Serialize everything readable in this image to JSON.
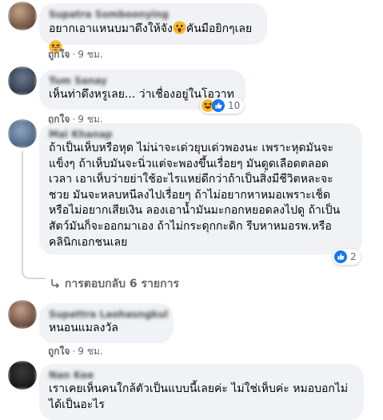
{
  "comments": [
    {
      "author": "Supatra Somboonying",
      "text": "อยากเอาแหนบมาดึงให้จัง",
      "emoji1": "face-with-open-mouth",
      "text_after_emoji": "คันมือยิกๆเลย",
      "emoji2": "grinning-squinting-face",
      "like_label": "ถูกใจ",
      "time": "9 ชม."
    },
    {
      "author": "Tum Sanay",
      "text": "เห็นท่าดึงหรูเลย... ว่าเชื่องอยู่ในโอวาท",
      "like_label": "ถูกใจ",
      "time": "9 ชม.",
      "reaction_count": "10",
      "reactions": [
        "haha",
        "like"
      ]
    },
    {
      "author": "Mai Khanap",
      "text": "ถ้าเป็นเห็บหรือหุด ไม่น่าจะเด่วยุบเด่วพองนะ เพราะหุดมันจะ\nแข็งๆ ถ้าเห็บมันจะนิ่วแต่จะพองขึ้นเรื่อยๆ มันดูดเลือดตลอด\nเวลา เอาเห็บว่ายย่าใช้อะไรแหย่ดีกว่าถ้าเป็นสิ่งมีชีวิตหละจะ\nชวย มันจะหลบหนีลงไปเรื่อยๆ ถ้าไม่อยากหาหมอเพราะเช็ด\nหรือไม่อยากเสียเงิน ลองเอาน้ำมันมะกอกหยอดลงไปดู ถ้าเป็น\nสัตว์มันก็จะออกมาเอง ถ้าไม่กระดุกกะดิก รีบหาหมอรพ.หรือ\nคลินิกเอกชนเลย",
      "reaction_count": "2",
      "reactions": [
        "like"
      ],
      "replies_label": "การตอบกลับ 6 รายการ"
    },
    {
      "author": "Supattra Laohasngkul",
      "text": "หนอนแมลงวัล",
      "like_label": "ถูกใจ",
      "time": "9 ชม."
    },
    {
      "author": "Nan Kee",
      "text": "เราเคยเห็นคนใกล้ตัวเป็นแบบนี้เลยค่ะ ไม่ใช่เห็บค่ะ หมอบอกไม่\nได้เป็นอะไร"
    }
  ],
  "colors": {
    "bubble": "#f0f2f5",
    "meta_text": "#65676b",
    "like_blue": "#1877f2",
    "haha_yellow": "#f7b928"
  }
}
